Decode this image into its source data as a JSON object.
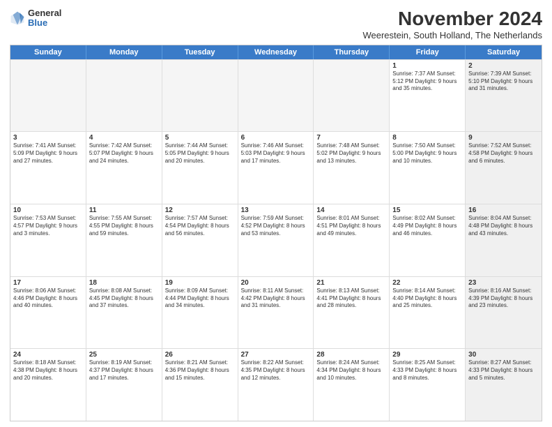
{
  "logo": {
    "line1": "General",
    "line2": "Blue"
  },
  "title": "November 2024",
  "subtitle": "Weerestein, South Holland, The Netherlands",
  "weekdays": [
    "Sunday",
    "Monday",
    "Tuesday",
    "Wednesday",
    "Thursday",
    "Friday",
    "Saturday"
  ],
  "weeks": [
    [
      {
        "day": "",
        "text": "",
        "empty": true
      },
      {
        "day": "",
        "text": "",
        "empty": true
      },
      {
        "day": "",
        "text": "",
        "empty": true
      },
      {
        "day": "",
        "text": "",
        "empty": true
      },
      {
        "day": "",
        "text": "",
        "empty": true
      },
      {
        "day": "1",
        "text": "Sunrise: 7:37 AM\nSunset: 5:12 PM\nDaylight: 9 hours and 35 minutes.",
        "shaded": false
      },
      {
        "day": "2",
        "text": "Sunrise: 7:39 AM\nSunset: 5:10 PM\nDaylight: 9 hours and 31 minutes.",
        "shaded": true
      }
    ],
    [
      {
        "day": "3",
        "text": "Sunrise: 7:41 AM\nSunset: 5:09 PM\nDaylight: 9 hours and 27 minutes.",
        "shaded": false
      },
      {
        "day": "4",
        "text": "Sunrise: 7:42 AM\nSunset: 5:07 PM\nDaylight: 9 hours and 24 minutes.",
        "shaded": false
      },
      {
        "day": "5",
        "text": "Sunrise: 7:44 AM\nSunset: 5:05 PM\nDaylight: 9 hours and 20 minutes.",
        "shaded": false
      },
      {
        "day": "6",
        "text": "Sunrise: 7:46 AM\nSunset: 5:03 PM\nDaylight: 9 hours and 17 minutes.",
        "shaded": false
      },
      {
        "day": "7",
        "text": "Sunrise: 7:48 AM\nSunset: 5:02 PM\nDaylight: 9 hours and 13 minutes.",
        "shaded": false
      },
      {
        "day": "8",
        "text": "Sunrise: 7:50 AM\nSunset: 5:00 PM\nDaylight: 9 hours and 10 minutes.",
        "shaded": false
      },
      {
        "day": "9",
        "text": "Sunrise: 7:52 AM\nSunset: 4:58 PM\nDaylight: 9 hours and 6 minutes.",
        "shaded": true
      }
    ],
    [
      {
        "day": "10",
        "text": "Sunrise: 7:53 AM\nSunset: 4:57 PM\nDaylight: 9 hours and 3 minutes.",
        "shaded": false
      },
      {
        "day": "11",
        "text": "Sunrise: 7:55 AM\nSunset: 4:55 PM\nDaylight: 8 hours and 59 minutes.",
        "shaded": false
      },
      {
        "day": "12",
        "text": "Sunrise: 7:57 AM\nSunset: 4:54 PM\nDaylight: 8 hours and 56 minutes.",
        "shaded": false
      },
      {
        "day": "13",
        "text": "Sunrise: 7:59 AM\nSunset: 4:52 PM\nDaylight: 8 hours and 53 minutes.",
        "shaded": false
      },
      {
        "day": "14",
        "text": "Sunrise: 8:01 AM\nSunset: 4:51 PM\nDaylight: 8 hours and 49 minutes.",
        "shaded": false
      },
      {
        "day": "15",
        "text": "Sunrise: 8:02 AM\nSunset: 4:49 PM\nDaylight: 8 hours and 46 minutes.",
        "shaded": false
      },
      {
        "day": "16",
        "text": "Sunrise: 8:04 AM\nSunset: 4:48 PM\nDaylight: 8 hours and 43 minutes.",
        "shaded": true
      }
    ],
    [
      {
        "day": "17",
        "text": "Sunrise: 8:06 AM\nSunset: 4:46 PM\nDaylight: 8 hours and 40 minutes.",
        "shaded": false
      },
      {
        "day": "18",
        "text": "Sunrise: 8:08 AM\nSunset: 4:45 PM\nDaylight: 8 hours and 37 minutes.",
        "shaded": false
      },
      {
        "day": "19",
        "text": "Sunrise: 8:09 AM\nSunset: 4:44 PM\nDaylight: 8 hours and 34 minutes.",
        "shaded": false
      },
      {
        "day": "20",
        "text": "Sunrise: 8:11 AM\nSunset: 4:42 PM\nDaylight: 8 hours and 31 minutes.",
        "shaded": false
      },
      {
        "day": "21",
        "text": "Sunrise: 8:13 AM\nSunset: 4:41 PM\nDaylight: 8 hours and 28 minutes.",
        "shaded": false
      },
      {
        "day": "22",
        "text": "Sunrise: 8:14 AM\nSunset: 4:40 PM\nDaylight: 8 hours and 25 minutes.",
        "shaded": false
      },
      {
        "day": "23",
        "text": "Sunrise: 8:16 AM\nSunset: 4:39 PM\nDaylight: 8 hours and 23 minutes.",
        "shaded": true
      }
    ],
    [
      {
        "day": "24",
        "text": "Sunrise: 8:18 AM\nSunset: 4:38 PM\nDaylight: 8 hours and 20 minutes.",
        "shaded": false
      },
      {
        "day": "25",
        "text": "Sunrise: 8:19 AM\nSunset: 4:37 PM\nDaylight: 8 hours and 17 minutes.",
        "shaded": false
      },
      {
        "day": "26",
        "text": "Sunrise: 8:21 AM\nSunset: 4:36 PM\nDaylight: 8 hours and 15 minutes.",
        "shaded": false
      },
      {
        "day": "27",
        "text": "Sunrise: 8:22 AM\nSunset: 4:35 PM\nDaylight: 8 hours and 12 minutes.",
        "shaded": false
      },
      {
        "day": "28",
        "text": "Sunrise: 8:24 AM\nSunset: 4:34 PM\nDaylight: 8 hours and 10 minutes.",
        "shaded": false
      },
      {
        "day": "29",
        "text": "Sunrise: 8:25 AM\nSunset: 4:33 PM\nDaylight: 8 hours and 8 minutes.",
        "shaded": false
      },
      {
        "day": "30",
        "text": "Sunrise: 8:27 AM\nSunset: 4:33 PM\nDaylight: 8 hours and 5 minutes.",
        "shaded": true
      }
    ]
  ]
}
